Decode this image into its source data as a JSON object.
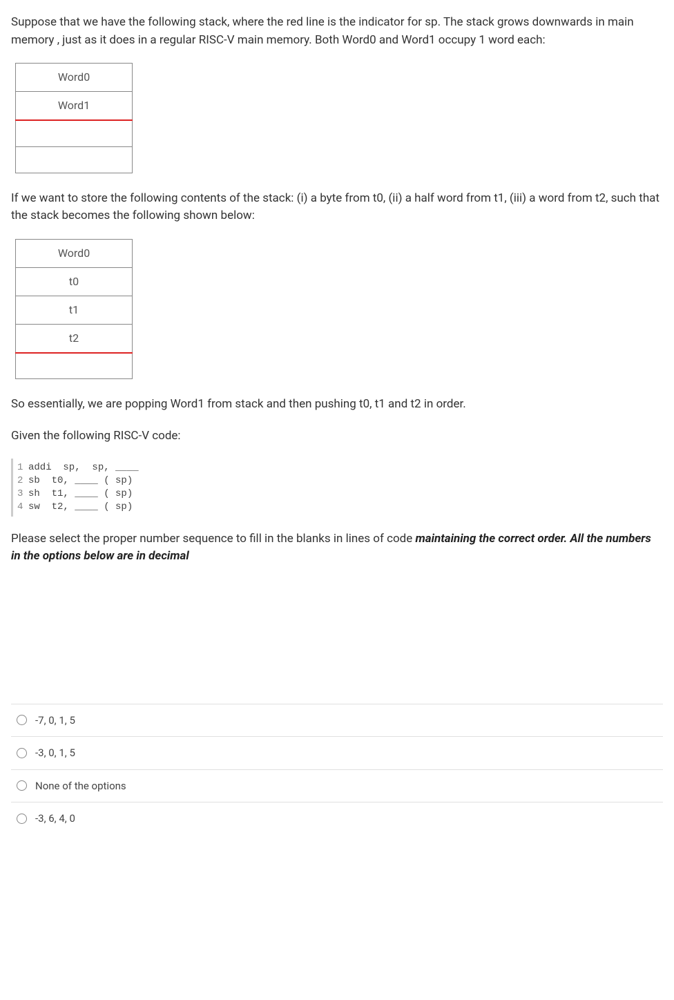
{
  "intro_paragraph": "Suppose that we have the following stack, where the red line is the indicator for sp. The stack grows downwards in main memory , just as it does in a regular RISC-V main memory. Both Word0 and Word1 occupy 1 word each:",
  "stack1": {
    "cell0": "Word0",
    "cell1": "Word1",
    "cell2": "",
    "cell3": ""
  },
  "mid_paragraph": "If we want to store the following contents of the stack: (i) a byte from t0, (ii) a half word from t1, (iii) a word from t2, such that the stack becomes the following shown below:",
  "stack2": {
    "cell0": "Word0",
    "cell1": "t0",
    "cell2": "t1",
    "cell3": "t2",
    "cell4": ""
  },
  "popping_paragraph": "So essentially, we are popping Word1 from stack and then pushing  t0, t1 and t2 in order.",
  "given_code_label": "Given the following RISC-V code:",
  "code_lines": {
    "l1": "addi  sp,  sp, ____",
    "l2": "sb  t0, ____ ( sp)",
    "l3": "sh  t1, ____ ( sp)",
    "l4": "sw  t2, ____ ( sp)"
  },
  "line_nums": {
    "n1": "1",
    "n2": "2",
    "n3": "3",
    "n4": "4"
  },
  "tail_part1": "Please select the proper number sequence to fill in the blanks in lines of code ",
  "tail_emph": "maintaining the correct order. All the numbers in the options below are in decimal",
  "options": {
    "o1": "-7, 0, 1, 5",
    "o2": "-3, 0, 1, 5",
    "o3": "None of the options",
    "o4": "-3, 6, 4, 0"
  }
}
